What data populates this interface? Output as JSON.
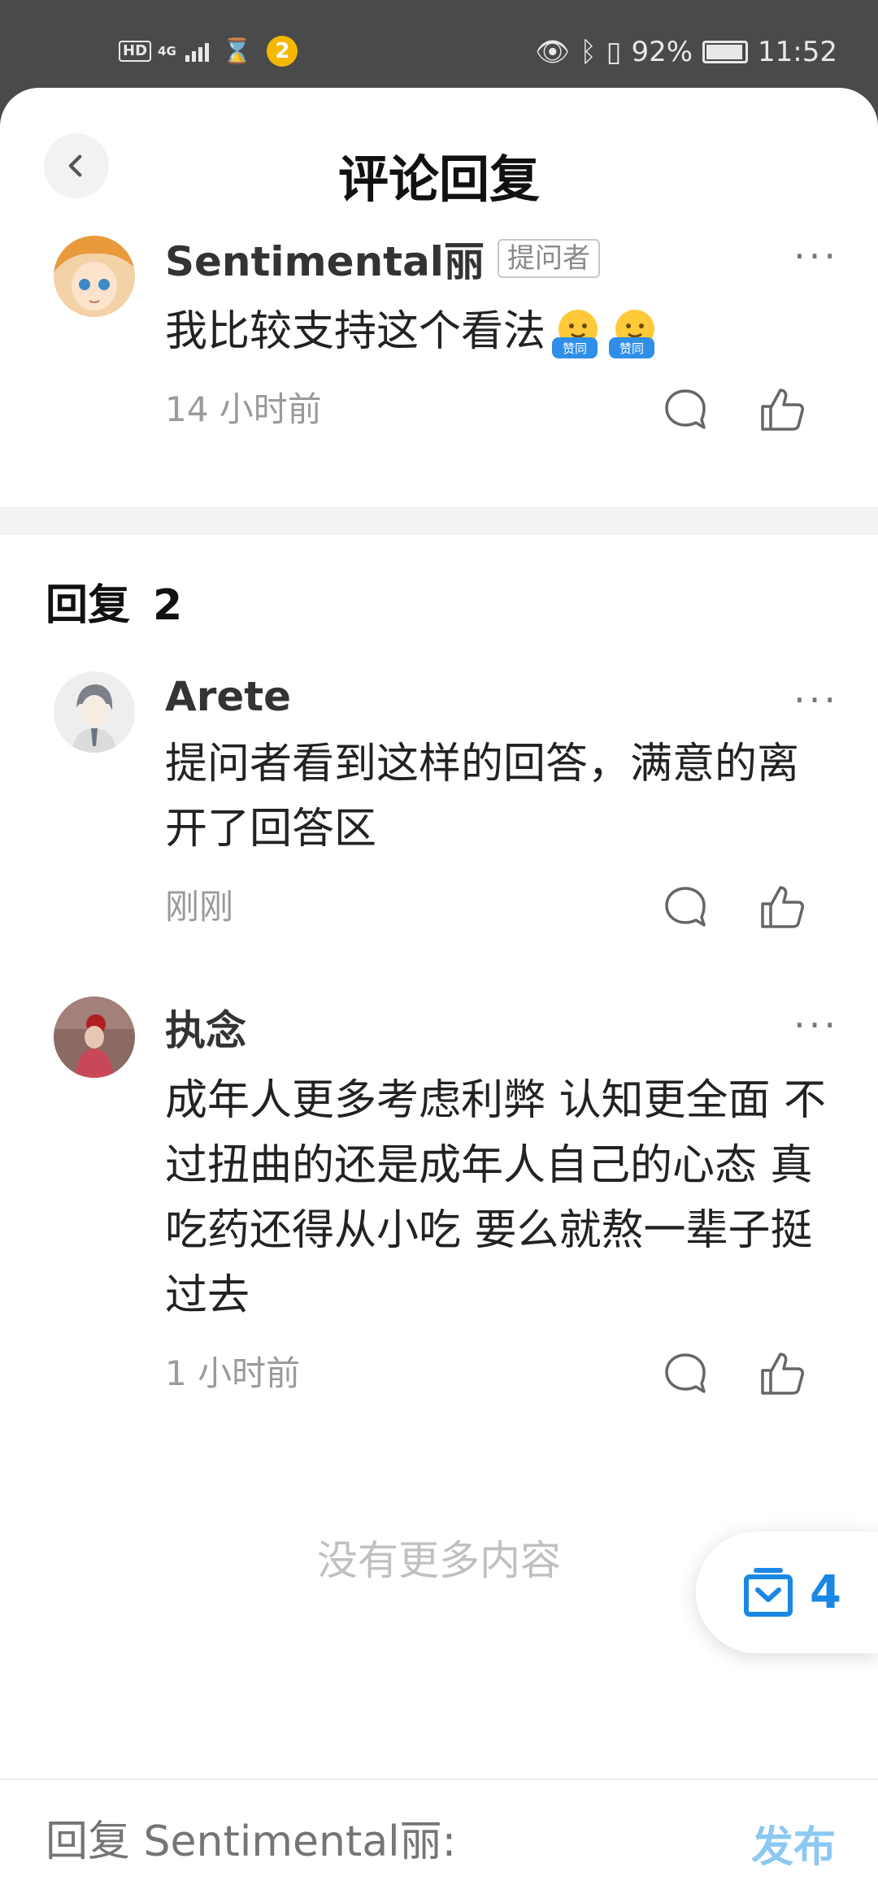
{
  "status_bar": {
    "network_hd": "HD",
    "network_type": "4G",
    "notification_badge": "2",
    "battery": "92%",
    "time": "11:52"
  },
  "header": {
    "title": "评论回复"
  },
  "main_comment": {
    "username": "Sentimental丽",
    "badge": "提问者",
    "text": "我比较支持这个看法",
    "emojis": [
      "赞同",
      "赞同"
    ],
    "time": "14 小时前"
  },
  "replies": {
    "label": "回复",
    "count": "2",
    "items": [
      {
        "username": "Arete",
        "text": "提问者看到这样的回答，满意的离开了回答区",
        "time": "刚刚"
      },
      {
        "username": "执念",
        "text": "成年人更多考虑利弊 认知更全面 不过扭曲的还是成年人自己的心态 真吃药还得从小吃 要么就熬一辈子挺过去",
        "time": "1 小时前"
      }
    ]
  },
  "no_more": "没有更多内容",
  "floating_button": {
    "count": "4"
  },
  "footer": {
    "placeholder": "回复 Sentimental丽:",
    "publish": "发布"
  },
  "colors": {
    "accent": "#1a87e5",
    "publish_disabled": "#8cc8f2",
    "muted": "#9a9a9a"
  }
}
